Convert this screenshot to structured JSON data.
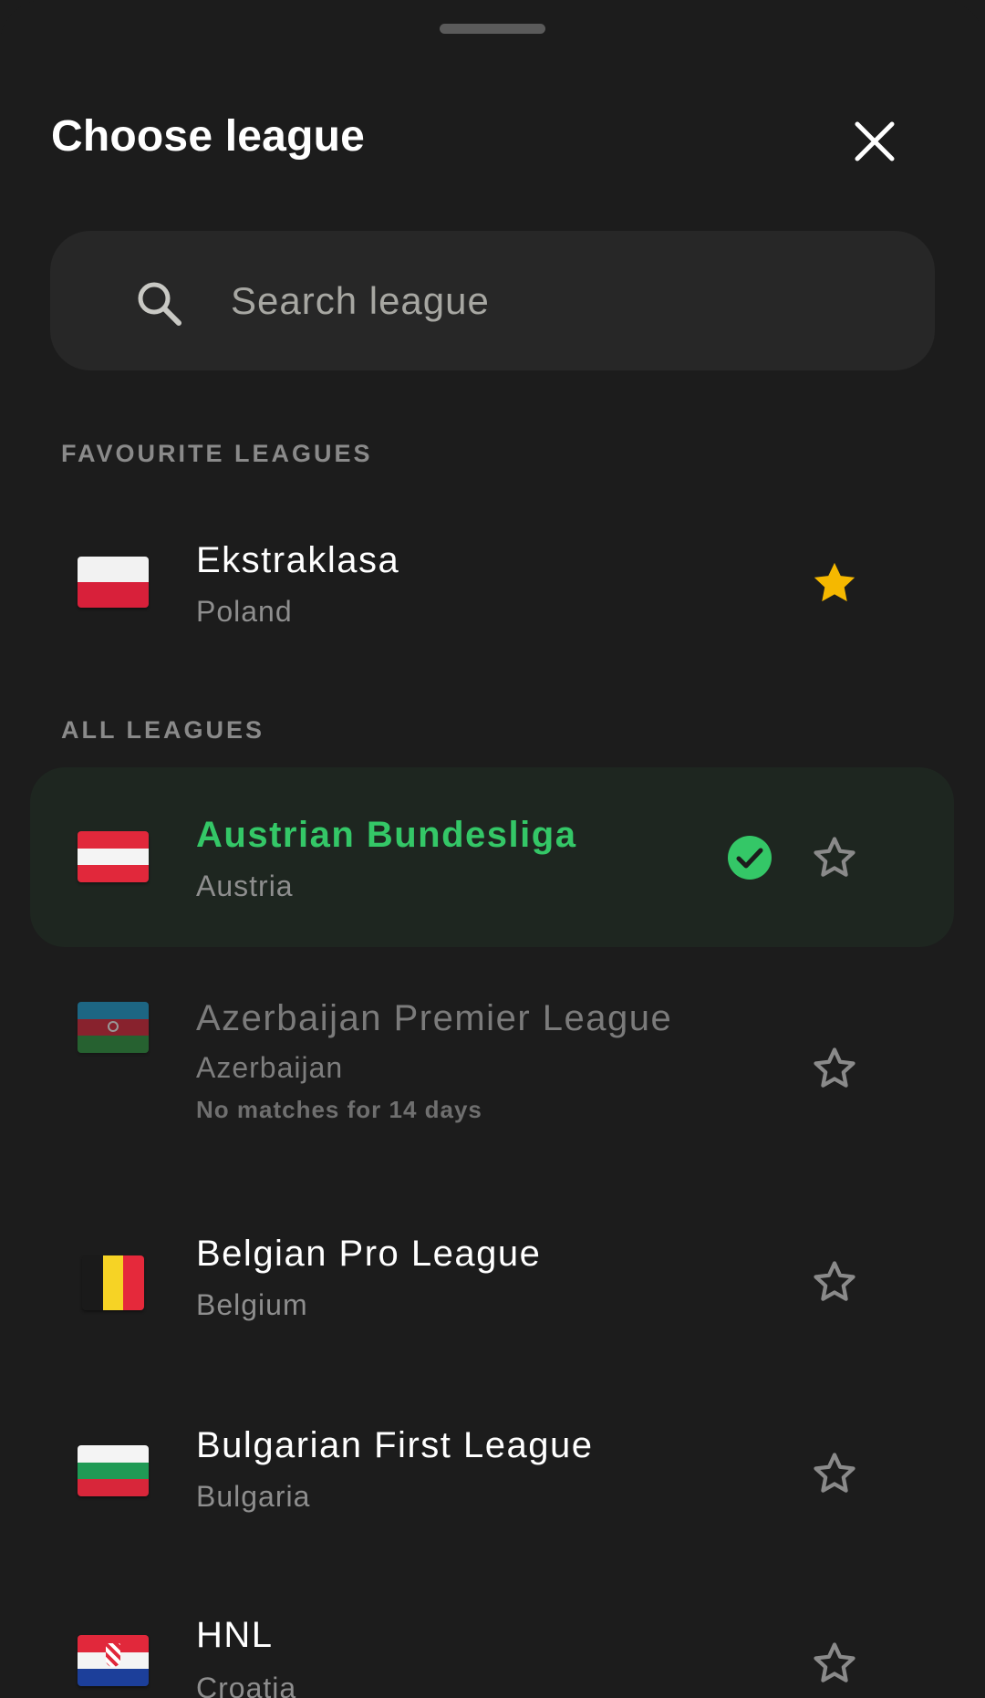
{
  "header": {
    "title": "Choose league"
  },
  "search": {
    "placeholder": "Search league",
    "value": ""
  },
  "sections": {
    "favourites": "FAVOURITE LEAGUES",
    "all": "ALL LEAGUES"
  },
  "favourites": [
    {
      "name": "Ekstraklasa",
      "country": "Poland",
      "flag": "poland-flag",
      "starred": true
    }
  ],
  "leagues": [
    {
      "name": "Austrian Bundesliga",
      "country": "Austria",
      "flag": "austria-flag",
      "selected": true,
      "starred": false
    },
    {
      "name": "Azerbaijan Premier League",
      "country": "Azerbaijan",
      "note": "No matches for 14 days",
      "flag": "azerbaijan-flag",
      "disabled": true,
      "starred": false
    },
    {
      "name": "Belgian Pro League",
      "country": "Belgium",
      "flag": "belgium-flag",
      "starred": false
    },
    {
      "name": "Bulgarian First League",
      "country": "Bulgaria",
      "flag": "bulgaria-flag",
      "starred": false
    },
    {
      "name": "HNL",
      "country": "Croatia",
      "flag": "croatia-flag",
      "starred": false
    }
  ],
  "colors": {
    "background": "#1c1c1c",
    "accent": "#34c767",
    "star_active": "#f5b800",
    "star_inactive": "#8a8a8a"
  }
}
